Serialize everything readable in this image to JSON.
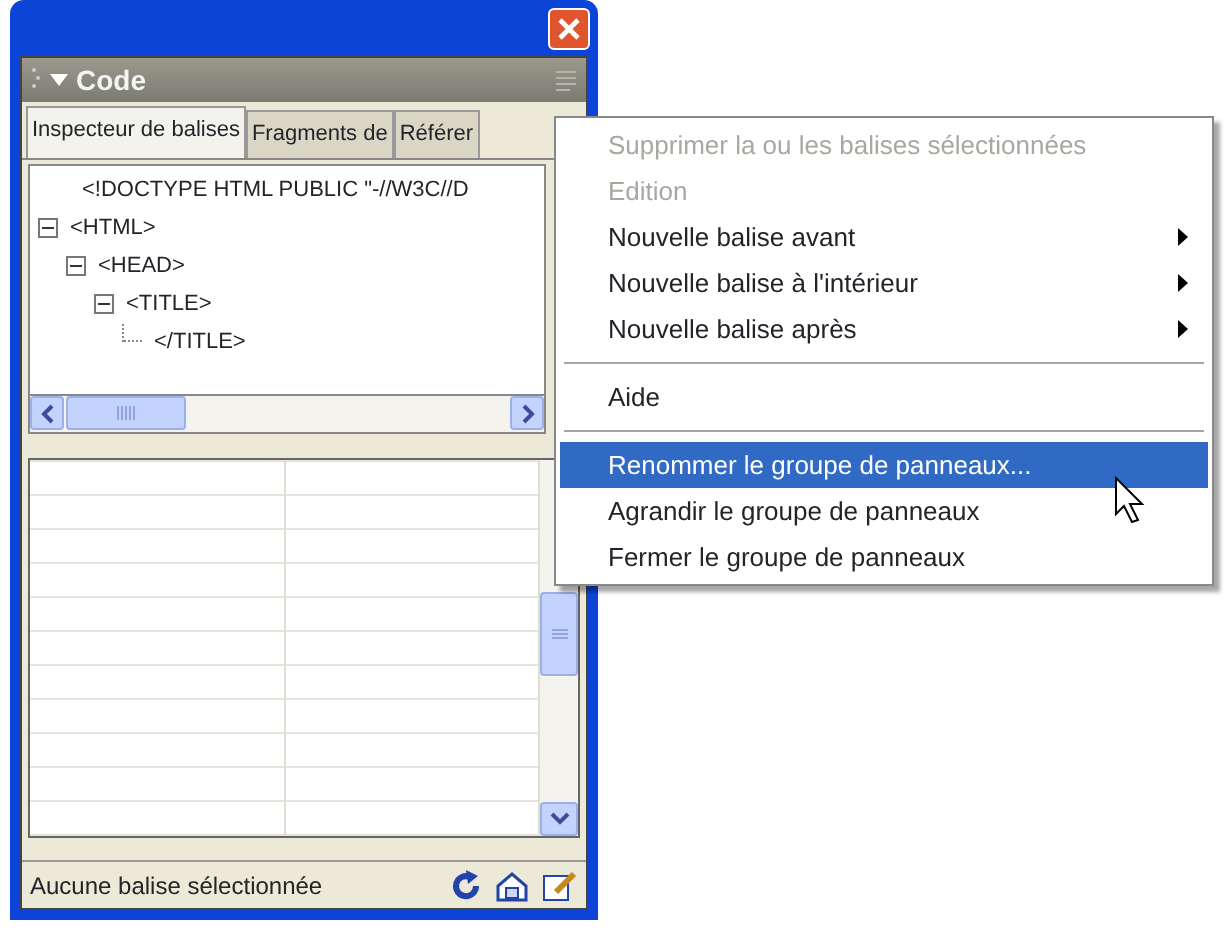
{
  "panel": {
    "title": "Code"
  },
  "tabs": [
    {
      "label": "Inspecteur de balises",
      "selected": true
    },
    {
      "label": "Fragments de",
      "selected": false
    },
    {
      "label": "Référer",
      "selected": false
    }
  ],
  "tree": [
    {
      "label": "<!DOCTYPE HTML PUBLIC \"-//W3C//D"
    },
    {
      "label": "<HTML>",
      "expanded": true,
      "children": [
        {
          "label": "<HEAD>",
          "expanded": true,
          "children": [
            {
              "label": "<TITLE>",
              "expanded": true,
              "children": [
                {
                  "label": "</TITLE>"
                }
              ]
            }
          ]
        }
      ]
    }
  ],
  "status_bar": {
    "text": "Aucune balise sélectionnée"
  },
  "context_menu": [
    {
      "kind": "item",
      "label": "Supprimer la ou les balises sélectionnées",
      "disabled": true,
      "submenu": false,
      "selected": false
    },
    {
      "kind": "item",
      "label": "Edition",
      "disabled": true,
      "submenu": false,
      "selected": false
    },
    {
      "kind": "item",
      "label": "Nouvelle balise avant",
      "disabled": false,
      "submenu": true,
      "selected": false
    },
    {
      "kind": "item",
      "label": "Nouvelle balise à l'intérieur",
      "disabled": false,
      "submenu": true,
      "selected": false
    },
    {
      "kind": "item",
      "label": "Nouvelle balise après",
      "disabled": false,
      "submenu": true,
      "selected": false
    },
    {
      "kind": "separator"
    },
    {
      "kind": "item",
      "label": "Aide",
      "disabled": false,
      "submenu": false,
      "selected": false
    },
    {
      "kind": "separator"
    },
    {
      "kind": "item",
      "label": "Renommer le groupe de panneaux...",
      "disabled": false,
      "submenu": false,
      "selected": true
    },
    {
      "kind": "item",
      "label": "Agrandir le groupe de panneaux",
      "disabled": false,
      "submenu": false,
      "selected": false
    },
    {
      "kind": "item",
      "label": "Fermer le groupe de panneaux",
      "disabled": false,
      "submenu": false,
      "selected": false
    }
  ]
}
